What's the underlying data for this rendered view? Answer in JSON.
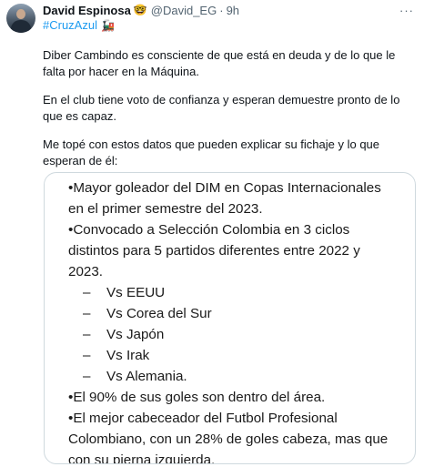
{
  "tweet": {
    "author_name": "David Espinosa",
    "author_emoji": "🤓",
    "handle": "@David_EG",
    "separator": "·",
    "time": "9h",
    "more_glyph": "···",
    "hashtag": "#CruzAzul",
    "hashtag_emoji": "🚂",
    "paragraphs": [
      "Diber Cambindo es consciente de que está en deuda y de lo que le falta por hacer en la Máquina.",
      "En el club tiene voto de confianza y esperan demuestre pronto de lo que es capaz.",
      "Me topé con estos datos que pueden explicar su fichaje y lo que esperan de él:"
    ]
  },
  "media_text": {
    "lines": [
      "•Mayor goleador del DIM en Copas Internacionales",
      "en el primer semestre del 2023.",
      "•Convocado a Selección Colombia en 3 ciclos",
      "distintos para 5 partidos diferentes entre 2022 y",
      "2023.",
      "•El 90% de sus goles son dentro del área.",
      "•El mejor cabeceador del Futbol Profesional",
      "Colombiano, con un 28% de goles cabeza, mas que",
      "con su pierna izquierda."
    ],
    "dash": "–",
    "opponents": [
      "Vs EEUU",
      "Vs Corea del Sur",
      "Vs Japón",
      "Vs Irak",
      "Vs Alemania."
    ]
  }
}
